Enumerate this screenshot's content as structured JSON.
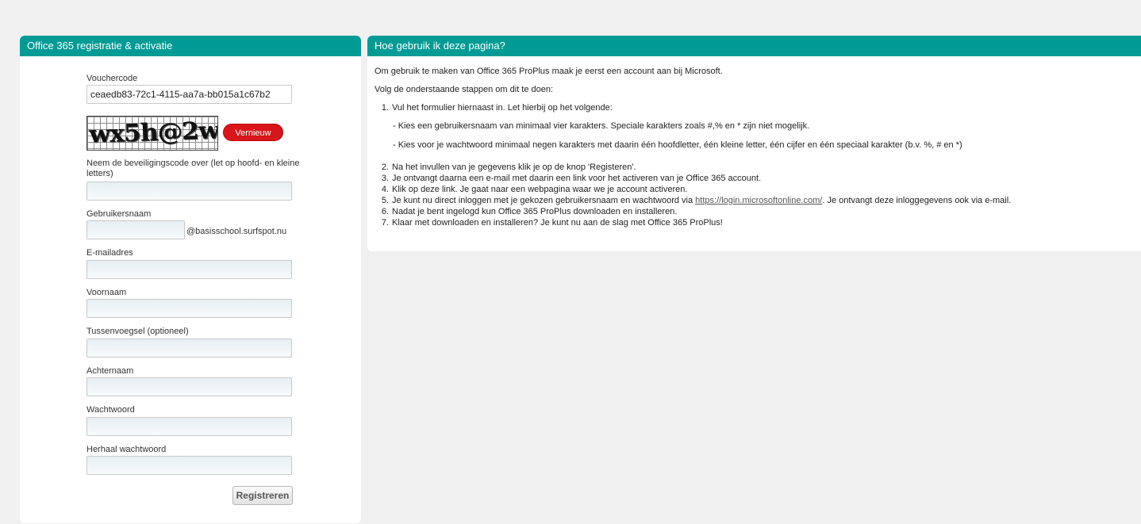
{
  "left_panel": {
    "title": "Office 365 registratie & activatie",
    "voucher_label": "Vouchercode",
    "voucher_value": "ceaedb83-72c1-4115-aa7a-bb015a1c67b2",
    "captcha_text": "wx5h@2w",
    "refresh_label": "Vernieuw",
    "security_label": "Neem de beveiligingscode over (let op hoofd- en kleine letters)",
    "username_label": "Gebruikersnaam",
    "username_suffix": "@basisschool.surfspot.nu",
    "email_label": "E-mailadres",
    "firstname_label": "Voornaam",
    "infix_label": "Tussenvoegsel (optioneel)",
    "lastname_label": "Achternaam",
    "password_label": "Wachtwoord",
    "repeat_password_label": "Herhaal wachtwoord",
    "submit_label": "Registreren"
  },
  "right_panel": {
    "title": "Hoe gebruik ik deze pagina?",
    "intro": "Om gebruik te maken van Office 365 ProPlus maak je eerst een account aan bij Microsoft.",
    "steps_intro": "Volg de onderstaande stappen om dit te doen:",
    "step1": "Vul het formulier hiernaast in. Let hierbij op het volgende:",
    "step1_sub1": "- Kies een gebruikersnaam van minimaal vier karakters. Speciale karakters zoals #,% en * zijn niet mogelijk.",
    "step1_sub2": "- Kies voor je wachtwoord minimaal negen karakters met daarin één hoofdletter, één kleine letter, één cijfer en één speciaal karakter (b.v. %, # en *)",
    "step2": "Na het invullen van je gegevens klik je op de knop 'Registeren'.",
    "step3": "Je ontvangt daarna een e-mail met daarin een link voor het activeren van je Office 365 account.",
    "step4": "Klik op deze link. Je gaat naar een webpagina waar we je account activeren.",
    "step5_pre": "Je kunt nu direct inloggen met je gekozen gebruikersnaam en wachtwoord via ",
    "step5_link": "https://login.microsoftonline.com/",
    "step5_post": ". Je ontvangt deze inloggegevens ook via e-mail.",
    "step6": "Nadat je bent ingelogd kun Office 365 ProPlus downloaden en installeren.",
    "step7": "Klaar met downloaden en installeren? Je kunt nu aan de slag met Office 365 ProPlus!",
    "numbers": [
      "1.",
      "2.",
      "3.",
      "4.",
      "5.",
      "6.",
      "7."
    ]
  }
}
